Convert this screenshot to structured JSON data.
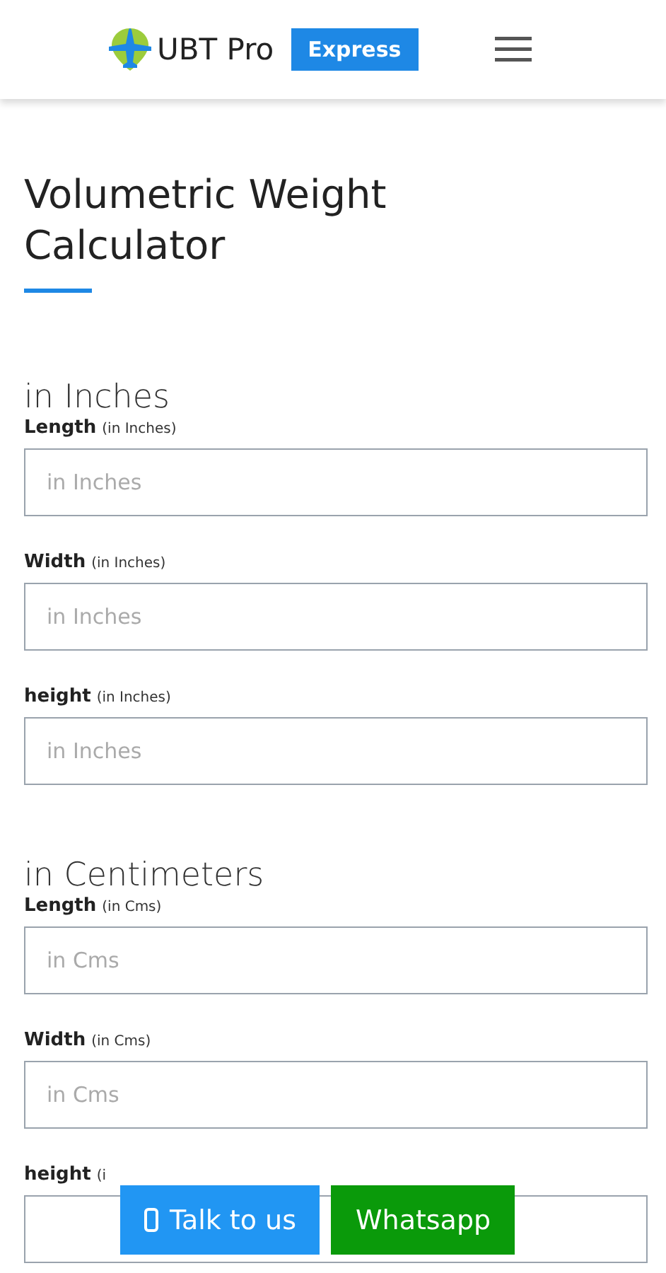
{
  "header": {
    "brand": "UBT Pro",
    "badge": "Express"
  },
  "title": "Volumetric Weight Calculator",
  "sections": [
    {
      "heading": "in Inches",
      "fields": [
        {
          "label": "Length",
          "unit": "(in Inches)",
          "placeholder": "in Inches"
        },
        {
          "label": "Width",
          "unit": "(in Inches)",
          "placeholder": "in Inches"
        },
        {
          "label": "height",
          "unit": "(in Inches)",
          "placeholder": "in Inches"
        }
      ]
    },
    {
      "heading": "in Centimeters",
      "fields": [
        {
          "label": "Length",
          "unit": "(in Cms)",
          "placeholder": "in Cms"
        },
        {
          "label": "Width",
          "unit": "(in Cms)",
          "placeholder": "in Cms"
        },
        {
          "label": "height",
          "unit": "(i"
        }
      ]
    }
  ],
  "floating_buttons": [
    {
      "kind": "call",
      "label": "Talk to us"
    },
    {
      "kind": "whatsapp",
      "label": "Whatsapp"
    }
  ]
}
